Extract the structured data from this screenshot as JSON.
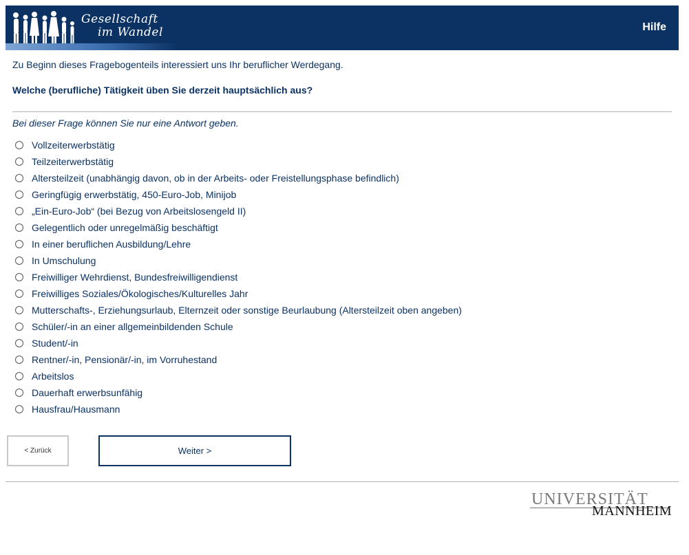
{
  "header": {
    "logo_line1": "Gesellschaft",
    "logo_line2": "im Wandel",
    "help_label": "Hilfe"
  },
  "survey": {
    "intro": "Zu Beginn dieses Fragebogenteils interessiert uns Ihr beruflicher Werdegang.",
    "question": "Welche (berufliche) Tätigkeit üben Sie derzeit hauptsächlich aus?",
    "hint": "Bei dieser Frage können Sie nur eine Antwort geben.",
    "options": [
      "Vollzeiterwerbstätig",
      "Teilzeiterwerbstätig",
      "Altersteilzeit (unabhängig davon, ob in der Arbeits- oder Freistellungsphase befindlich)",
      "Geringfügig erwerbstätig, 450-Euro-Job, Minijob",
      "„Ein-Euro-Job“ (bei Bezug von Arbeitslosengeld II)",
      "Gelegentlich oder unregelmäßig beschäftigt",
      "In einer beruflichen Ausbildung/Lehre",
      "In Umschulung",
      "Freiwilliger Wehrdienst, Bundesfreiwilligendienst",
      "Freiwilliges Soziales/Ökologisches/Kulturelles Jahr",
      "Mutterschafts-, Erziehungsurlaub, Elternzeit oder sonstige Beurlaubung (Altersteilzeit oben angeben)",
      "Schüler/-in an einer allgemeinbildenden Schule",
      "Student/-in",
      "Rentner/-in, Pensionär/-in, im Vorruhestand",
      "Arbeitslos",
      "Dauerhaft erwerbsunfähig",
      "Hausfrau/Hausmann"
    ]
  },
  "nav": {
    "back_label": "< Zurück",
    "next_label": "Weiter >"
  },
  "footer": {
    "logo_top": "UNIVERSITÄT",
    "logo_bottom": "MANNHEIM"
  }
}
